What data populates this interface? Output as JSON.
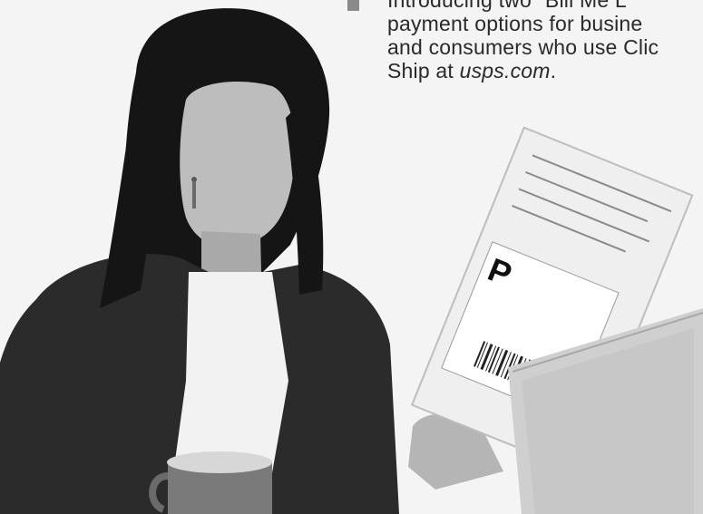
{
  "bullet": {
    "line1": "Introducing two \"Bill Me L",
    "line2": "payment options for busine",
    "line3": "and consumers who use Clic",
    "line4_prefix": "Ship at ",
    "line4_link": "usps.com",
    "line4_suffix": "."
  },
  "package_label": {
    "priority_letter": "P"
  },
  "colors": {
    "background": "#f4f4f4",
    "jacket": "#2b2b2b",
    "hair": "#151515",
    "shirt": "#f2f2f2",
    "skin": "#b7b7b7",
    "laptop": "#c9c9c9",
    "mug": "#7a7a7a"
  }
}
